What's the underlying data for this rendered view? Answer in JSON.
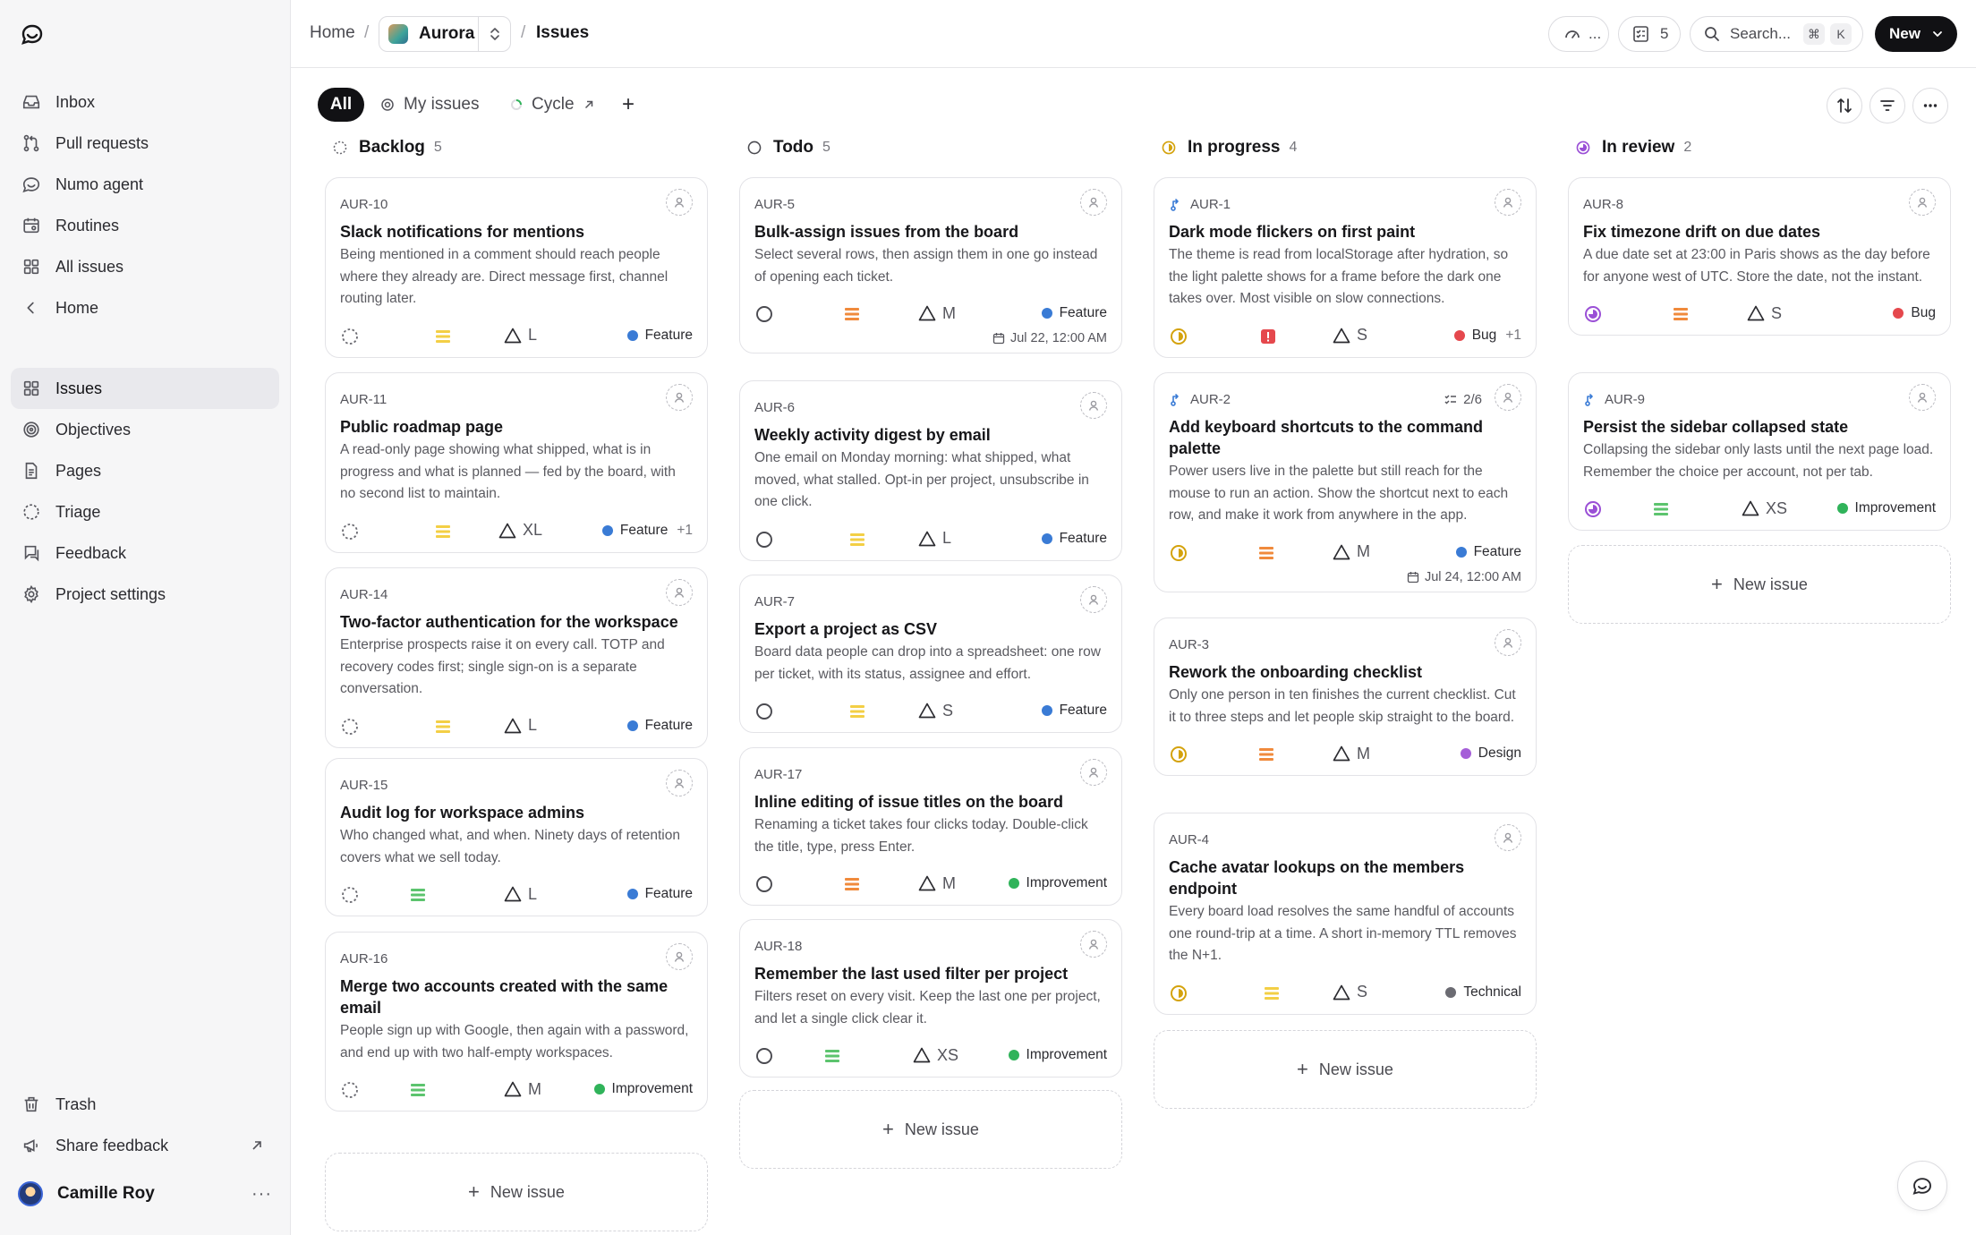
{
  "sidebar": {
    "primary": [
      {
        "label": "Inbox",
        "icon": "inbox-icon"
      },
      {
        "label": "Pull requests",
        "icon": "pull-request-icon"
      },
      {
        "label": "Numo agent",
        "icon": "agent-icon"
      },
      {
        "label": "Routines",
        "icon": "calendar-icon"
      },
      {
        "label": "All issues",
        "icon": "grid-icon"
      },
      {
        "label": "Home",
        "icon": "chevron-left-icon"
      }
    ],
    "project": [
      {
        "label": "Issues",
        "icon": "grid-icon",
        "active": true
      },
      {
        "label": "Objectives",
        "icon": "target-icon"
      },
      {
        "label": "Pages",
        "icon": "document-icon"
      },
      {
        "label": "Triage",
        "icon": "triage-icon"
      },
      {
        "label": "Feedback",
        "icon": "feedback-icon"
      },
      {
        "label": "Project settings",
        "icon": "gear-icon"
      }
    ],
    "footer": {
      "trash": "Trash",
      "share": "Share feedback"
    },
    "user": {
      "name": "Camille Roy",
      "more": "···"
    }
  },
  "topbar": {
    "home": "Home",
    "sep": "/",
    "project": "Aurora",
    "current": "Issues",
    "perf": "...",
    "tasks_count": "5",
    "search_placeholder": "Search...",
    "kbd_cmd": "⌘",
    "kbd_k": "K",
    "new_label": "New"
  },
  "views": {
    "all": "All",
    "mine": "My issues",
    "cycle": "Cycle",
    "add": "+"
  },
  "colors": {
    "feature": "#3a7bd5",
    "bug": "#e5484d",
    "improvement": "#30b35a",
    "design": "#a55fd8",
    "technical": "#6b6b72",
    "in_progress": "#d4a20c",
    "in_review": "#9a4fd6"
  },
  "columns": [
    {
      "title": "Backlog",
      "count": "5",
      "status": "backlog",
      "new_issue": "New issue",
      "cards": [
        {
          "id": "AUR-10",
          "title": "Slack notifications for mentions",
          "desc": "Being mentioned in a comment should reach people where they already are. Direct message first, channel routing later.",
          "priority": "low",
          "estimate": "L",
          "label": "Feature",
          "label_color": "#3a7bd5"
        },
        {
          "id": "AUR-11",
          "title": "Public roadmap page",
          "desc": "A read-only page showing what shipped, what is in progress and what is planned — fed by the board, with no second list to maintain.",
          "priority": "low",
          "estimate": "XL",
          "label": "Feature",
          "label_color": "#3a7bd5",
          "extra": "+1"
        },
        {
          "id": "AUR-14",
          "title": "Two-factor authentication for the workspace",
          "desc": "Enterprise prospects raise it on every call. TOTP and recovery codes first; single sign-on is a separate conversation.",
          "priority": "low",
          "estimate": "L",
          "label": "Feature",
          "label_color": "#3a7bd5"
        },
        {
          "id": "AUR-15",
          "title": "Audit log for workspace admins",
          "desc": "Who changed what, and when. Ninety days of retention covers what we sell today.",
          "priority": "none",
          "estimate": "L",
          "label": "Feature",
          "label_color": "#3a7bd5"
        },
        {
          "id": "AUR-16",
          "title": "Merge two accounts created with the same email",
          "desc": "People sign up with Google, then again with a password, and end up with two half-empty workspaces.",
          "priority": "none",
          "estimate": "M",
          "label": "Improvement",
          "label_color": "#30b35a"
        }
      ]
    },
    {
      "title": "Todo",
      "count": "5",
      "status": "todo",
      "new_issue": "New issue",
      "cards": [
        {
          "id": "AUR-5",
          "title": "Bulk-assign issues from the board",
          "desc": "Select several rows, then assign them in one go instead of opening each ticket.",
          "priority": "high",
          "estimate": "M",
          "label": "Feature",
          "label_color": "#3a7bd5",
          "due": "Jul 22, 12:00 AM"
        },
        {
          "id": "AUR-6",
          "title": "Weekly activity digest by email",
          "desc": "One email on Monday morning: what shipped, what moved, what stalled. Opt-in per project, unsubscribe in one click.",
          "priority": "low",
          "estimate": "L",
          "label": "Feature",
          "label_color": "#3a7bd5"
        },
        {
          "id": "AUR-7",
          "title": "Export a project as CSV",
          "desc": "Board data people can drop into a spreadsheet: one row per ticket, with its status, assignee and effort.",
          "priority": "low",
          "estimate": "S",
          "label": "Feature",
          "label_color": "#3a7bd5"
        },
        {
          "id": "AUR-17",
          "title": "Inline editing of issue titles on the board",
          "desc": "Renaming a ticket takes four clicks today. Double-click the title, type, press Enter.",
          "priority": "high",
          "estimate": "M",
          "label": "Improvement",
          "label_color": "#30b35a"
        },
        {
          "id": "AUR-18",
          "title": "Remember the last used filter per project",
          "desc": "Filters reset on every visit. Keep the last one per project, and let a single click clear it.",
          "priority": "none",
          "estimate": "XS",
          "label": "Improvement",
          "label_color": "#30b35a"
        }
      ]
    },
    {
      "title": "In progress",
      "count": "4",
      "status": "in_progress",
      "new_issue": "New issue",
      "cards": [
        {
          "id": "AUR-1",
          "pr": true,
          "title": "Dark mode flickers on first paint",
          "desc": "The theme is read from localStorage after hydration, so the light palette shows for a frame before the dark one takes over. Most visible on slow connections.",
          "priority": "urgent",
          "estimate": "S",
          "label": "Bug",
          "label_color": "#e5484d",
          "extra": "+1"
        },
        {
          "id": "AUR-2",
          "pr": true,
          "subtasks": "2/6",
          "title": "Add keyboard shortcuts to the command palette",
          "desc": "Power users live in the palette but still reach for the mouse to run an action. Show the shortcut next to each row, and make it work from anywhere in the app.",
          "priority": "high",
          "estimate": "M",
          "label": "Feature",
          "label_color": "#3a7bd5",
          "due": "Jul 24, 12:00 AM"
        },
        {
          "id": "AUR-3",
          "title": "Rework the onboarding checklist",
          "desc": "Only one person in ten finishes the current checklist. Cut it to three steps and let people skip straight to the board.",
          "priority": "high",
          "estimate": "M",
          "label": "Design",
          "label_color": "#a55fd8"
        },
        {
          "id": "AUR-4",
          "title": "Cache avatar lookups on the members endpoint",
          "desc": "Every board load resolves the same handful of accounts one round-trip at a time. A short in-memory TTL removes the N+1.",
          "priority": "low",
          "estimate": "S",
          "label": "Technical",
          "label_color": "#6b6b72"
        }
      ]
    },
    {
      "title": "In review",
      "count": "2",
      "status": "in_review",
      "new_issue": "New issue",
      "cards": [
        {
          "id": "AUR-8",
          "title": "Fix timezone drift on due dates",
          "desc": "A due date set at 23:00 in Paris shows as the day before for anyone west of UTC. Store the date, not the instant.",
          "priority": "high",
          "estimate": "S",
          "label": "Bug",
          "label_color": "#e5484d"
        },
        {
          "id": "AUR-9",
          "pr": true,
          "title": "Persist the sidebar collapsed state",
          "desc": "Collapsing the sidebar only lasts until the next page load. Remember the choice per account, not per tab.",
          "priority": "none",
          "estimate": "XS",
          "label": "Improvement",
          "label_color": "#30b35a"
        }
      ]
    }
  ]
}
